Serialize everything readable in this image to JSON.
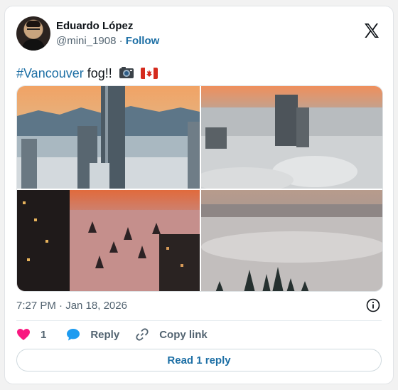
{
  "author": {
    "name": "Eduardo López",
    "handle": "@mini_1908",
    "separator": "·",
    "follow_label": "Follow"
  },
  "tweet": {
    "hashtag": "#Vancouver",
    "text": " fog!!",
    "emojis": [
      "camera-emoji",
      "canada-flag-emoji"
    ]
  },
  "media": {
    "photos": [
      {
        "name": "vancouver-fog-tower-mountains"
      },
      {
        "name": "vancouver-fog-towers-sunrise"
      },
      {
        "name": "vancouver-fog-pink-trees"
      },
      {
        "name": "vancouver-fog-grey-forest"
      }
    ]
  },
  "meta": {
    "timestamp": "7:27 PM · Jan 18, 2026"
  },
  "actions": {
    "like_count": "1",
    "reply_label": "Reply",
    "copy_link_label": "Copy link"
  },
  "footer": {
    "read_replies_label": "Read 1 reply"
  },
  "colors": {
    "accent": "#1d6fa5",
    "like": "#f91880",
    "reply_icon": "#1d9bf0",
    "muted": "#536471"
  }
}
